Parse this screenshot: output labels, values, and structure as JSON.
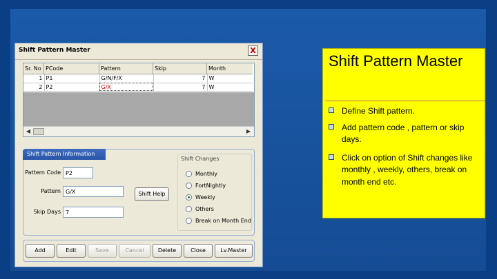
{
  "window": {
    "title": "Shift Pattern Master",
    "close_glyph": "X"
  },
  "grid": {
    "columns": [
      "Sr. No",
      "PCode",
      "Pattern",
      "Skip",
      "Month"
    ],
    "rows": [
      {
        "sr": "1",
        "pcode": "P1",
        "pattern": "G/N/F/X",
        "skip": "7",
        "month": "W"
      },
      {
        "sr": "2",
        "pcode": "P2",
        "pattern": "G/X",
        "skip": "7",
        "month": "W"
      }
    ]
  },
  "info": {
    "tab_label": "Shift Pattern Information",
    "pattern_code_label": "Pattern Code",
    "pattern_code_value": "P2",
    "pattern_label": "Pattern",
    "pattern_value": "G/X",
    "skip_days_label": "Skip Days",
    "skip_days_value": "7",
    "shift_help_label": "Shift Help"
  },
  "shift_changes": {
    "title": "Shift Changes",
    "options": [
      "Monthly",
      "FortNightly",
      "Weekly",
      "Others",
      "Break on Month End"
    ],
    "selected": "Weekly"
  },
  "buttons": {
    "add": "Add",
    "edit": "Edit",
    "save": "Save",
    "cancel": "Cancel",
    "delete": "Delete",
    "close": "Close",
    "lvmaster": "Lv.Master"
  },
  "note": {
    "title": "Shift Pattern Master",
    "bullets": [
      "Define Shift pattern.",
      "Add pattern code , pattern or skip days.",
      "Click on option of Shift changes  like monthly , weekly, others, break on month end etc."
    ]
  },
  "colors": {
    "background": "#0a3f86",
    "note_fill": "#ffff00",
    "selected_cell_text": "#cc0000"
  }
}
